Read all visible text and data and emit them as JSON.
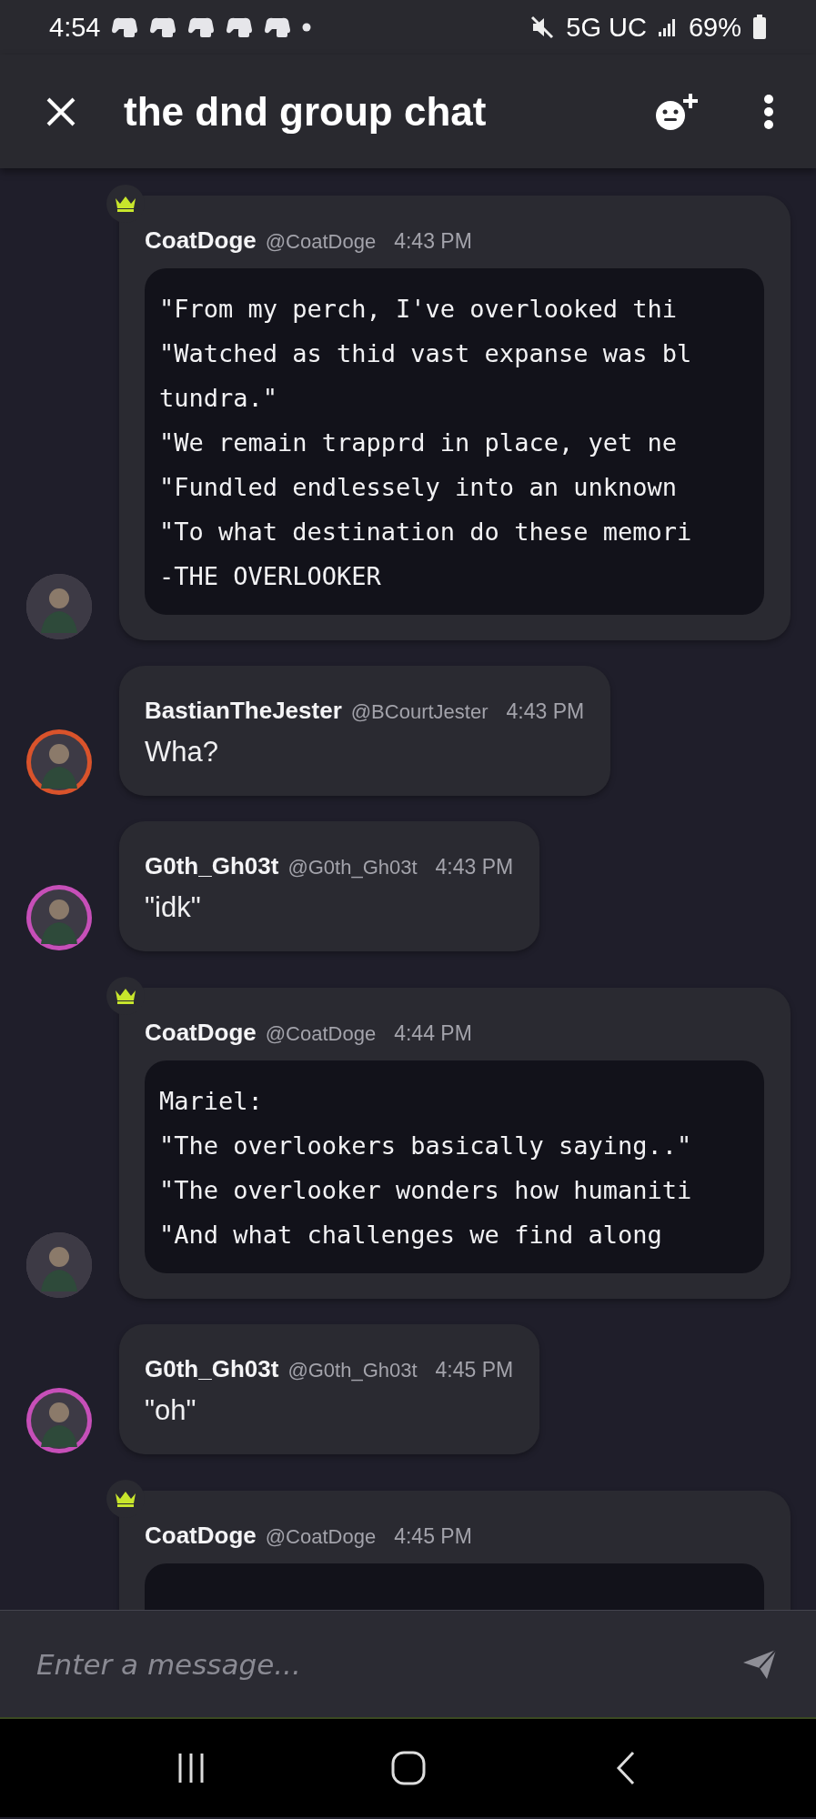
{
  "status_bar": {
    "time": "4:54",
    "network": "5G UC",
    "battery": "69%"
  },
  "header": {
    "title": "the dnd group chat"
  },
  "messages": [
    {
      "author": "CoatDoge",
      "handle": "@CoatDoge",
      "time": "4:43 PM",
      "crown": true,
      "kind": "code",
      "lines": [
        "\"From my perch, I've overlooked thi",
        "\"Watched as thid vast expanse was bl",
        "tundra.\"",
        "\"We remain trapprd in place, yet ne",
        "\"Fundled endlessely into an unknown",
        "\"To what destination do these memori",
        "-THE OVERLOOKER"
      ]
    },
    {
      "author": "BastianTheJester",
      "handle": "@BCourtJester",
      "time": "4:43 PM",
      "crown": false,
      "kind": "text",
      "text": "Wha?",
      "color": "#d9532b"
    },
    {
      "author": "G0th_Gh03t",
      "handle": "@G0th_Gh03t",
      "time": "4:43 PM",
      "crown": false,
      "kind": "text",
      "text": "\"idk\"",
      "color": "#c64fb8"
    },
    {
      "author": "CoatDoge",
      "handle": "@CoatDoge",
      "time": "4:44 PM",
      "crown": true,
      "kind": "code",
      "lines": [
        "Mariel:",
        "\"The overlookers basically saying..\"",
        "\"The overlooker wonders how humaniti",
        "\"And what challenges we find along"
      ]
    },
    {
      "author": "G0th_Gh03t",
      "handle": "@G0th_Gh03t",
      "time": "4:45 PM",
      "crown": false,
      "kind": "text",
      "text": "\"oh\"",
      "color": "#c64fb8"
    },
    {
      "author": "CoatDoge",
      "handle": "@CoatDoge",
      "time": "4:45 PM",
      "crown": true,
      "kind": "code"
    }
  ],
  "composer": {
    "placeholder": "Enter a message..."
  }
}
